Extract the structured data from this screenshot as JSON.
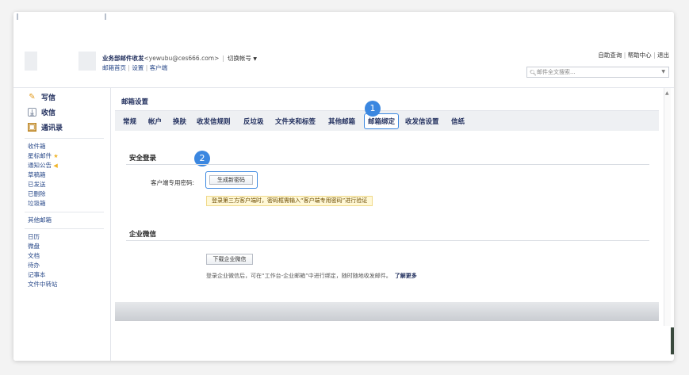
{
  "header": {
    "account_name": "业务部邮件收发",
    "account_email": "<yewubu@ces666.com>",
    "separator": "|",
    "switch_label": "切换帐号",
    "sub_links": [
      "邮箱首页",
      "设置",
      "客户端"
    ],
    "sub_sep": "|",
    "top_right_links": [
      "自助查询",
      "帮助中心",
      "退出"
    ],
    "search_placeholder": "邮件全文搜索..."
  },
  "sidebar": {
    "main_items": [
      {
        "label": "写信",
        "icon": "pencil-icon"
      },
      {
        "label": "收信",
        "icon": "inbox-icon"
      },
      {
        "label": "通讯录",
        "icon": "contacts-icon"
      }
    ],
    "folders": [
      "收件箱",
      "星标邮件",
      "通知公告",
      "草稿箱",
      "已发送",
      "已删除",
      "垃圾箱"
    ],
    "other_mailbox": "其他邮箱",
    "apps": [
      "日历",
      "微盘",
      "文档",
      "待办",
      "记事本",
      "文件中转站"
    ]
  },
  "main": {
    "title": "邮箱设置",
    "tabs": [
      "常规",
      "帐户",
      "换肤",
      "收发信规则",
      "反垃圾",
      "文件夹和标签",
      "其他邮箱",
      "邮箱绑定",
      "收发信设置",
      "信纸"
    ],
    "active_tab_index": 7,
    "badge_1": "1",
    "badge_2": "2",
    "security": {
      "title": "安全登录",
      "field_label": "客户端专用密码:",
      "button_label": "生成新密码",
      "notice": "登录第三方客户端时，密码框需输入“客户端专用密码”进行验证"
    },
    "wework": {
      "title": "企业微信",
      "button_label": "下载企业微信",
      "desc": "登录企业微信后，可在“工作台-企业邮箱”中进行绑定，随时随地收发邮件。",
      "more_link": "了解更多"
    }
  },
  "colors": {
    "accent_blue": "#3b87e0",
    "nav_text": "#1f2d5c",
    "notice_bg": "#fff8d6"
  }
}
